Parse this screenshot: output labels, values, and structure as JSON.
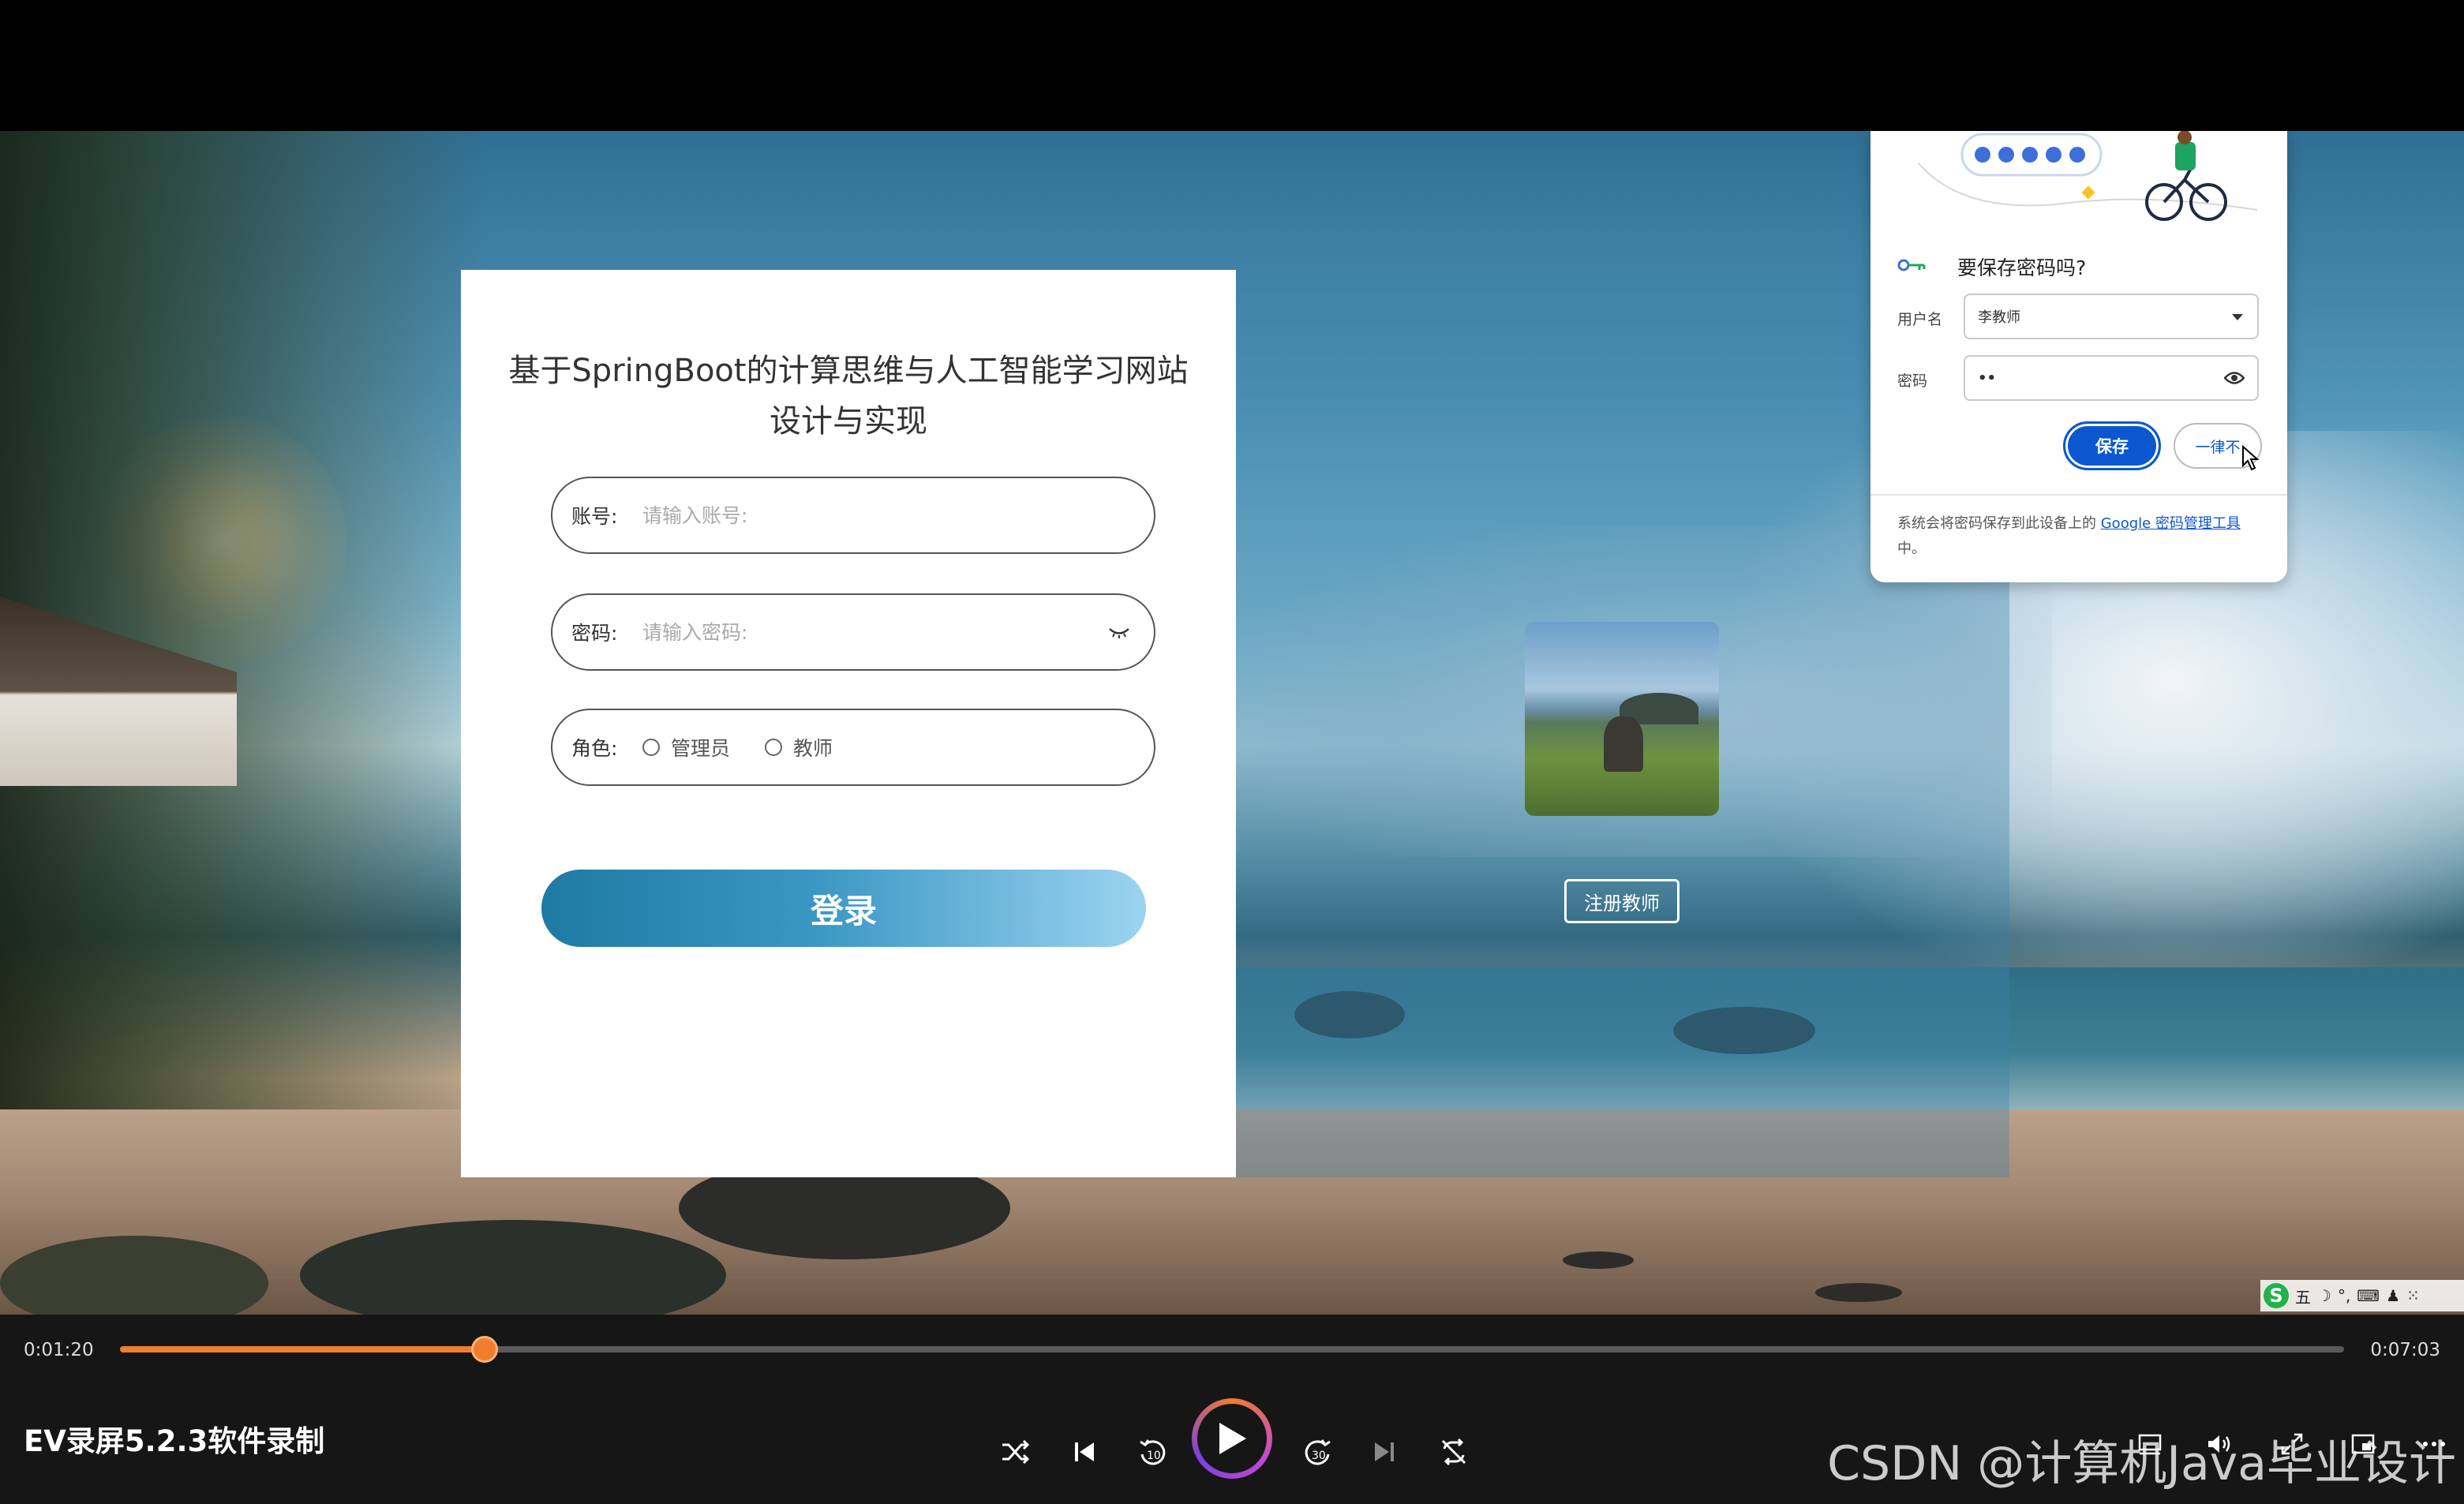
{
  "login": {
    "title": "基于SpringBoot的计算思维与人工智能学习网站设计与实现",
    "account_label": "账号:",
    "account_placeholder": "请输入账号:",
    "password_label": "密码:",
    "password_placeholder": "请输入密码:",
    "role_label": "角色:",
    "role_options": [
      "管理员",
      "教师"
    ],
    "login_button": "登录"
  },
  "right_panel": {
    "register_button": "注册教师"
  },
  "password_popup": {
    "title": "要保存密码吗?",
    "username_label": "用户名",
    "username_value": "李教师",
    "password_label": "密码",
    "password_value": "••",
    "save_button": "保存",
    "never_button": "一律不",
    "note_prefix": "系统会将密码保存到此设备上的 ",
    "note_link": "Google 密码管理工具",
    "note_suffix": "中。"
  },
  "ime": {
    "logo": "S",
    "mode": "五",
    "items": [
      "☽",
      "°,",
      "⌨",
      "♟",
      "⁙"
    ]
  },
  "player": {
    "time_current": "0:01:20",
    "time_total": "0:07:03",
    "progress_fraction": 0.164,
    "caption": "EV录屏5.2.3软件录制",
    "watermark": "CSDN @计算机Java毕业设计",
    "accent_color": "#f07e2a"
  }
}
